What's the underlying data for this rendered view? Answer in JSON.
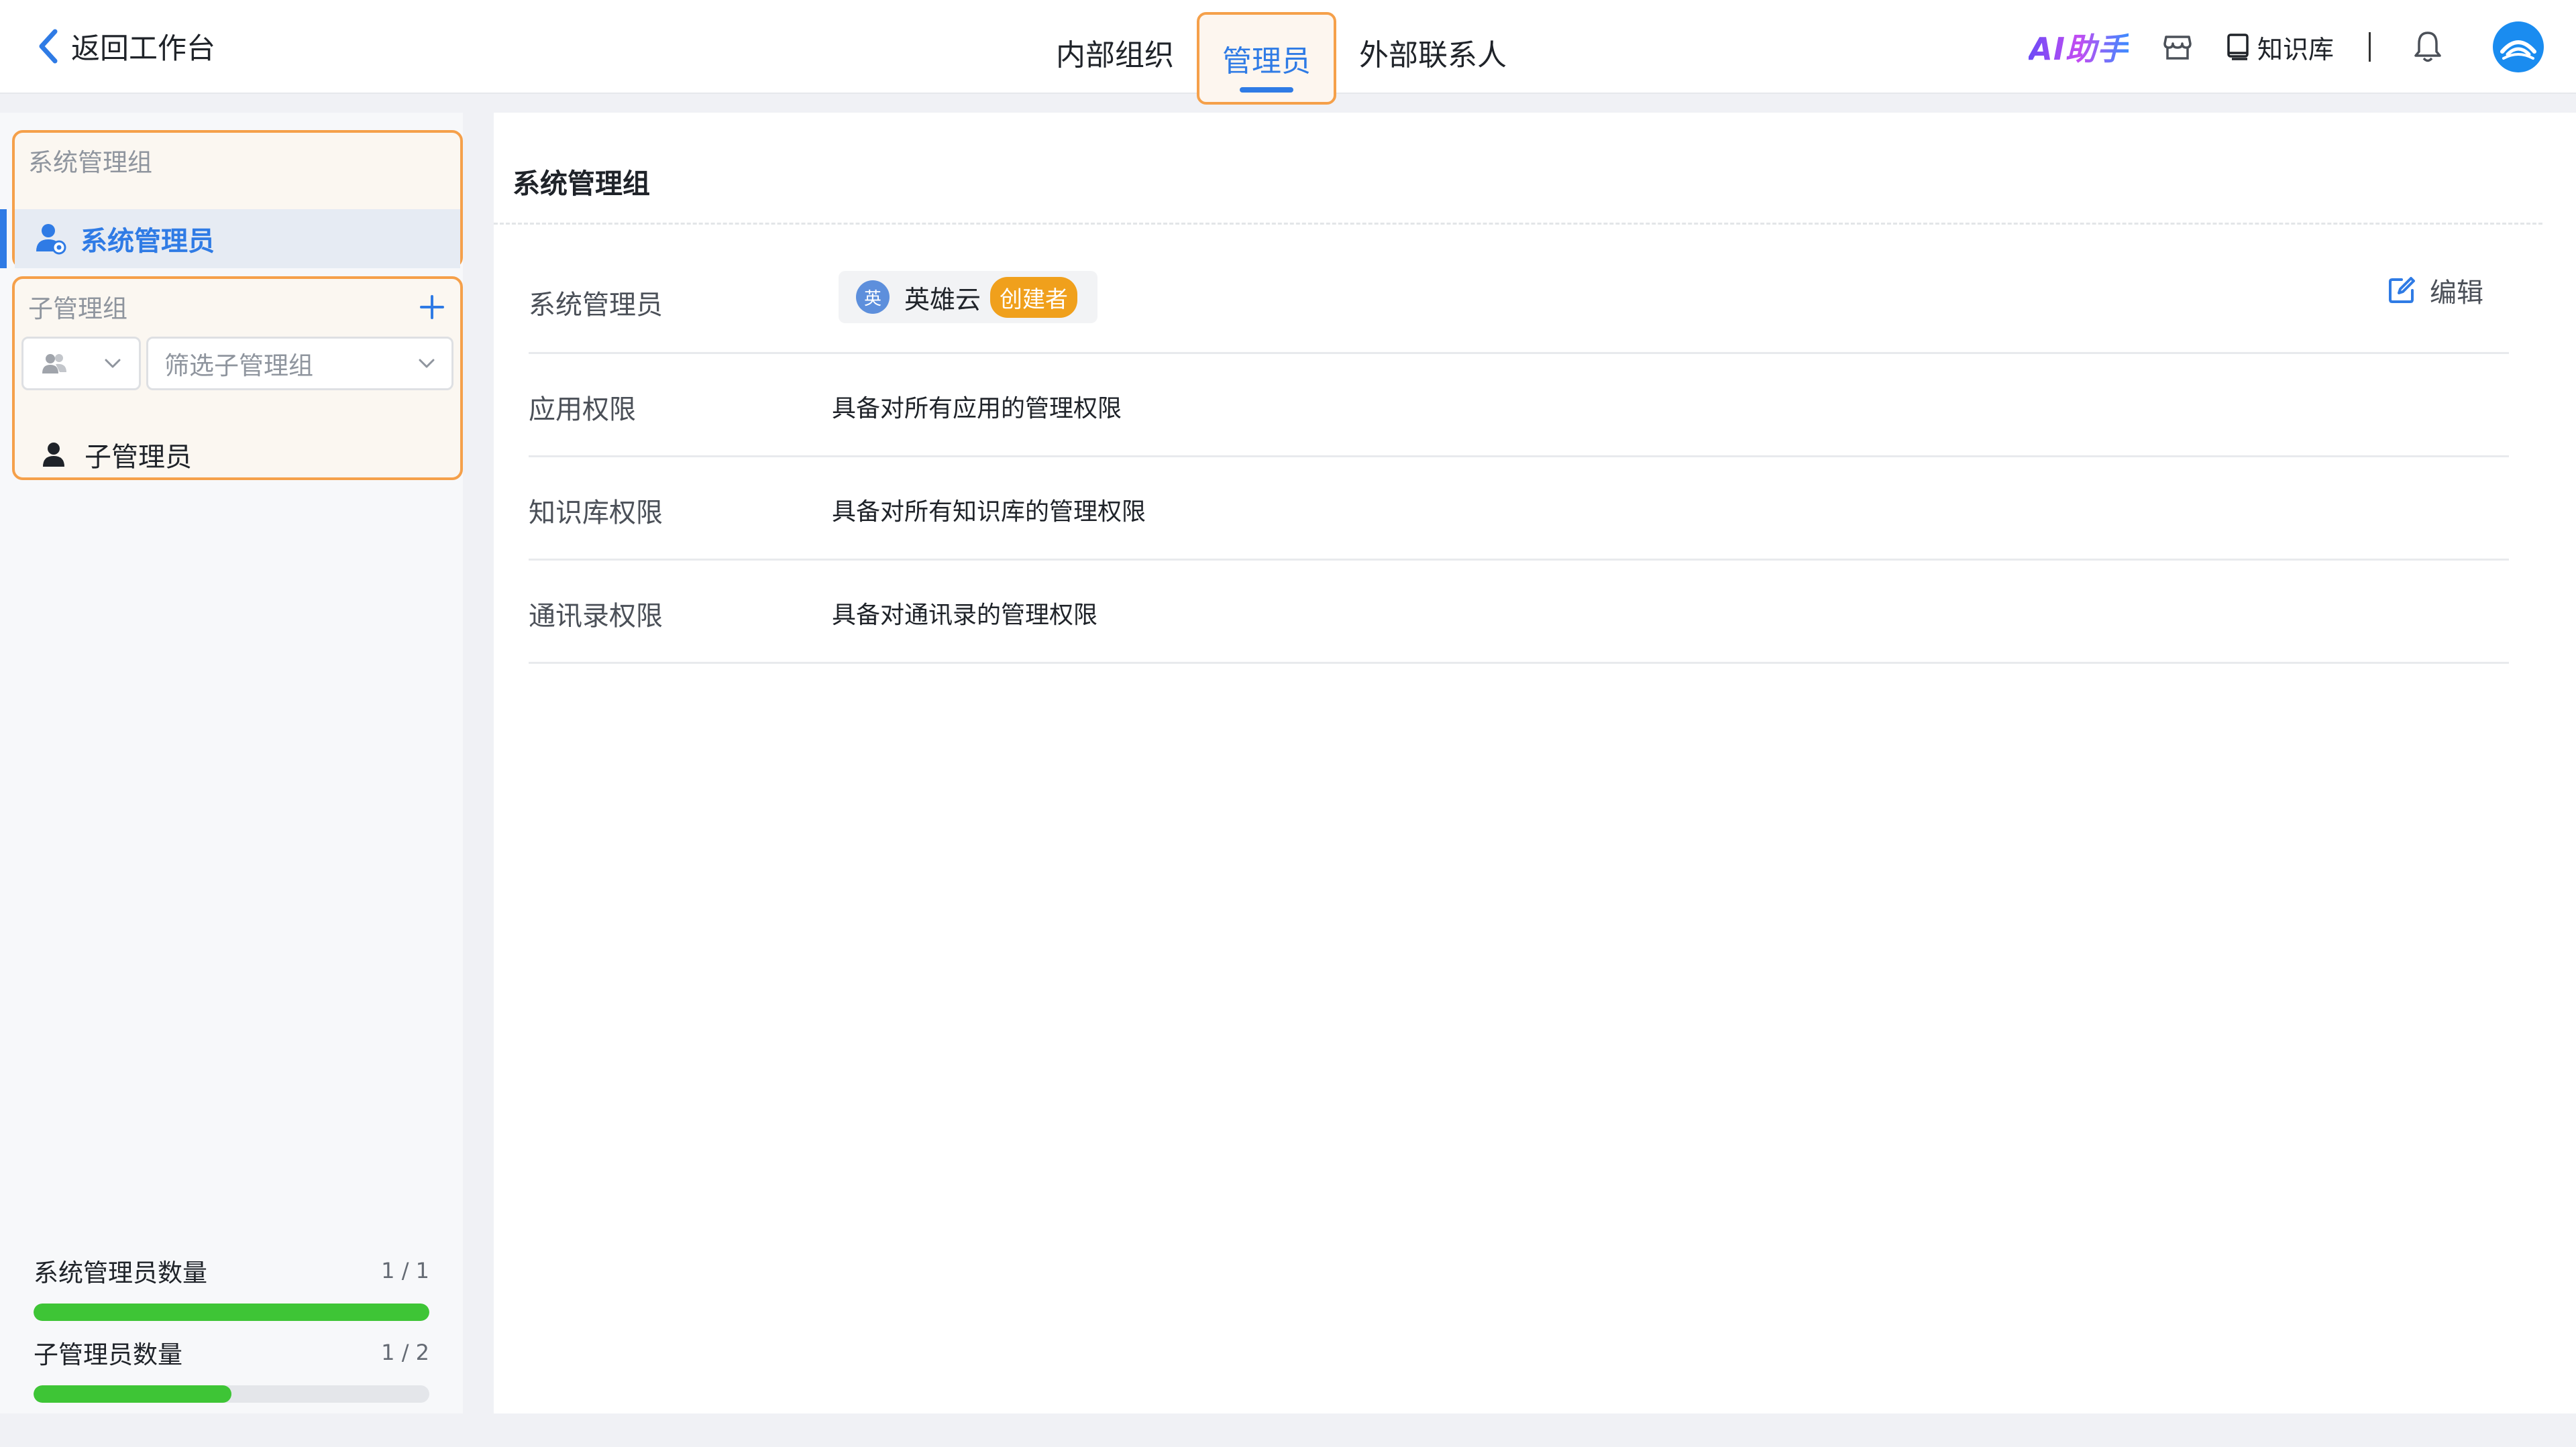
{
  "header": {
    "back_label": "返回工作台",
    "tabs": [
      {
        "label": "内部组织",
        "active": false
      },
      {
        "label": "管理员",
        "active": true
      },
      {
        "label": "外部联系人",
        "active": false
      }
    ],
    "ai_label": "AI助手",
    "kb_label": "知识库"
  },
  "sidebar": {
    "system_group_title": "系统管理组",
    "system_item_label": "系统管理员",
    "sub_group_title": "子管理组",
    "sub_filter_placeholder": "筛选子管理组",
    "sub_item_label": "子管理员",
    "quotas": [
      {
        "name": "系统管理员数量",
        "count": "1 / 1",
        "used": 1,
        "total": 1
      },
      {
        "name": "子管理员数量",
        "count": "1 / 2",
        "used": 1,
        "total": 2
      }
    ]
  },
  "main": {
    "title": "系统管理组",
    "edit_label": "编辑",
    "rows": [
      {
        "label": "系统管理员",
        "member": {
          "avatar_text": "英",
          "name": "英雄云",
          "badge": "创建者"
        }
      },
      {
        "label": "应用权限",
        "value": "具备对所有应用的管理权限"
      },
      {
        "label": "知识库权限",
        "value": "具备对所有知识库的管理权限"
      },
      {
        "label": "通讯录权限",
        "value": "具备对通讯录的管理权限"
      }
    ]
  },
  "colors": {
    "accent": "#2f7be5",
    "highlight_border": "#f5a04a",
    "progress": "#3ec536",
    "badge": "#f0a01c"
  },
  "icons": [
    "chevron-left-icon",
    "store-icon",
    "book-icon",
    "bell-icon",
    "app-logo-icon",
    "admin-user-icon",
    "plus-icon",
    "group-icon",
    "chevron-down-icon",
    "user-icon",
    "edit-icon"
  ]
}
